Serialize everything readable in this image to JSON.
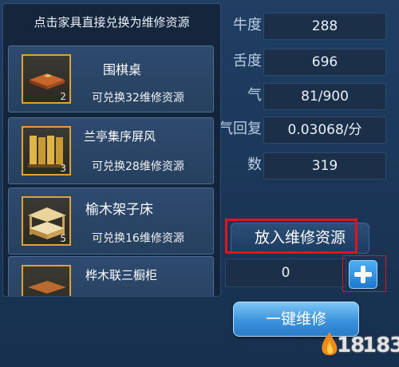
{
  "panel": {
    "stats": [
      {
        "label": "牛度",
        "value": "288"
      },
      {
        "label": "舌度",
        "value": "696"
      },
      {
        "label": "气",
        "value": "81/900"
      },
      {
        "label": "气回复",
        "value": "0.03068/分"
      },
      {
        "label": "数",
        "value": "319"
      }
    ],
    "deposit_button": "放入维修资源",
    "amount": "0",
    "repair_button": "一键维修"
  },
  "popup": {
    "header": "点击家具直接兑换为维修资源",
    "items": [
      {
        "name": "围棋桌",
        "qty": "2",
        "desc": "可兑换32维修资源"
      },
      {
        "name": "兰亭集序屏风",
        "qty": "3",
        "desc": "可兑换28维修资源"
      },
      {
        "name": "榆木架子床",
        "qty": "5",
        "desc": "可兑换16维修资源"
      },
      {
        "name": "桦木联三橱柜",
        "qty": "",
        "desc": ""
      }
    ]
  },
  "watermark": {
    "part1": "18",
    "part2": "183"
  },
  "colors": {
    "accent_red": "#e0151b",
    "item_border": "#e0a238",
    "button_blue": "#3b92dc"
  }
}
